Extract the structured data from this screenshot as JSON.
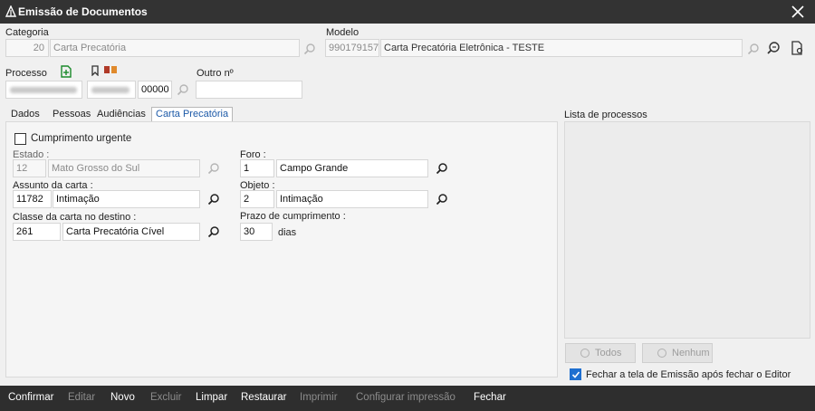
{
  "window": {
    "title": "Emissão de Documentos"
  },
  "categoria": {
    "label": "Categoria",
    "code": "20",
    "name": "Carta Precatória"
  },
  "modelo": {
    "label": "Modelo",
    "code": "990179157",
    "name": "Carta Precatória Eletrônica - TESTE"
  },
  "processo": {
    "label": "Processo",
    "part3": "00000"
  },
  "outro": {
    "label": "Outro nº",
    "value": ""
  },
  "tabs": [
    {
      "label": "Dados"
    },
    {
      "label": "Pessoas"
    },
    {
      "label": "Audiências"
    },
    {
      "label": "Carta Precatória"
    }
  ],
  "form": {
    "urgent_label": "Cumprimento urgente",
    "estado": {
      "label": "Estado :",
      "code": "12",
      "name": "Mato Grosso do Sul"
    },
    "foro": {
      "label": "Foro :",
      "code": "1",
      "name": "Campo Grande"
    },
    "assunto": {
      "label": "Assunto da carta :",
      "code": "11782",
      "name": "Intimação"
    },
    "objeto": {
      "label": "Objeto :",
      "code": "2",
      "name": "Intimação"
    },
    "classe": {
      "label": "Classe da carta no destino :",
      "code": "261",
      "name": "Carta Precatória Cível"
    },
    "prazo": {
      "label": "Prazo de cumprimento :",
      "value": "30",
      "unit": "dias"
    }
  },
  "lista": {
    "label": "Lista de processos",
    "todos": "Todos",
    "nenhum": "Nenhum",
    "fechar_label": "Fechar a tela de Emissão após fechar o Editor"
  },
  "toolbar": {
    "confirmar": "Confirmar",
    "editar": "Editar",
    "novo": "Novo",
    "excluir": "Excluir",
    "limpar": "Limpar",
    "restaurar": "Restaurar",
    "imprimir": "Imprimir",
    "configurar": "Configurar impressão",
    "fechar": "Fechar"
  }
}
